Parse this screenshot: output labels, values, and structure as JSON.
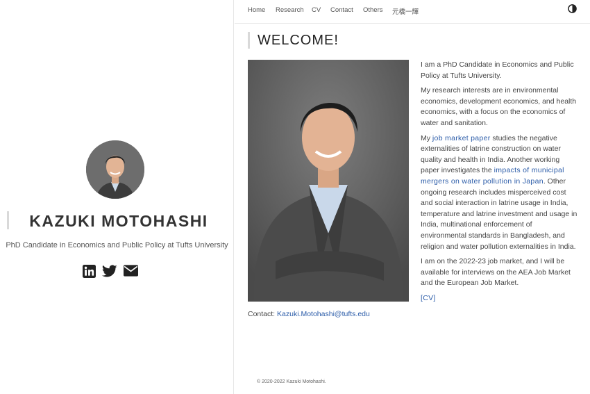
{
  "sidebar": {
    "name": "KAZUKI MOTOHASHI",
    "tagline": "PhD Candidate in Economics and Public Policy at Tufts University",
    "social": [
      "linkedin-icon",
      "twitter-icon",
      "envelope-icon"
    ]
  },
  "nav": {
    "items": [
      "Home",
      "Research",
      "CV",
      "Contact",
      "Others",
      "元橋一輝"
    ],
    "theme_icon": "contrast-icon"
  },
  "main": {
    "title": "WELCOME!",
    "contact_label": "Contact:",
    "contact_email": "Kazuki.Motohashi@tufts.edu",
    "bio": {
      "p1": "I am a PhD Candidate in Economics and Public Policy at Tufts University.",
      "p2": "My research interests are in environmental economics, development economics, and health economics, with a focus on the economics of water and sanitation.",
      "p3_a": "My ",
      "p3_link1": "job market paper",
      "p3_b": " studies the negative externalities of latrine construction on water quality and health in India. Another working paper investigates the ",
      "p3_link2": "impacts of municipal mergers on water pollution in Japan",
      "p3_c": ". Other ongoing research includes misperceived cost and social interaction in latrine usage in India, temperature and latrine investment and usage in India, multinational enforcement of environmental standards in Bangladesh, and religion and water pollution externalities in India.",
      "p4": "I am on the 2022-23 job market, and I will be available for interviews on the AEA Job Market and the European Job Market.",
      "cv_link": "[CV]"
    }
  },
  "footer": "© 2020-2022 Kazuki Motohashi.",
  "colors": {
    "link": "#2a5ba8",
    "accent_bar": "#d9d9d9"
  }
}
